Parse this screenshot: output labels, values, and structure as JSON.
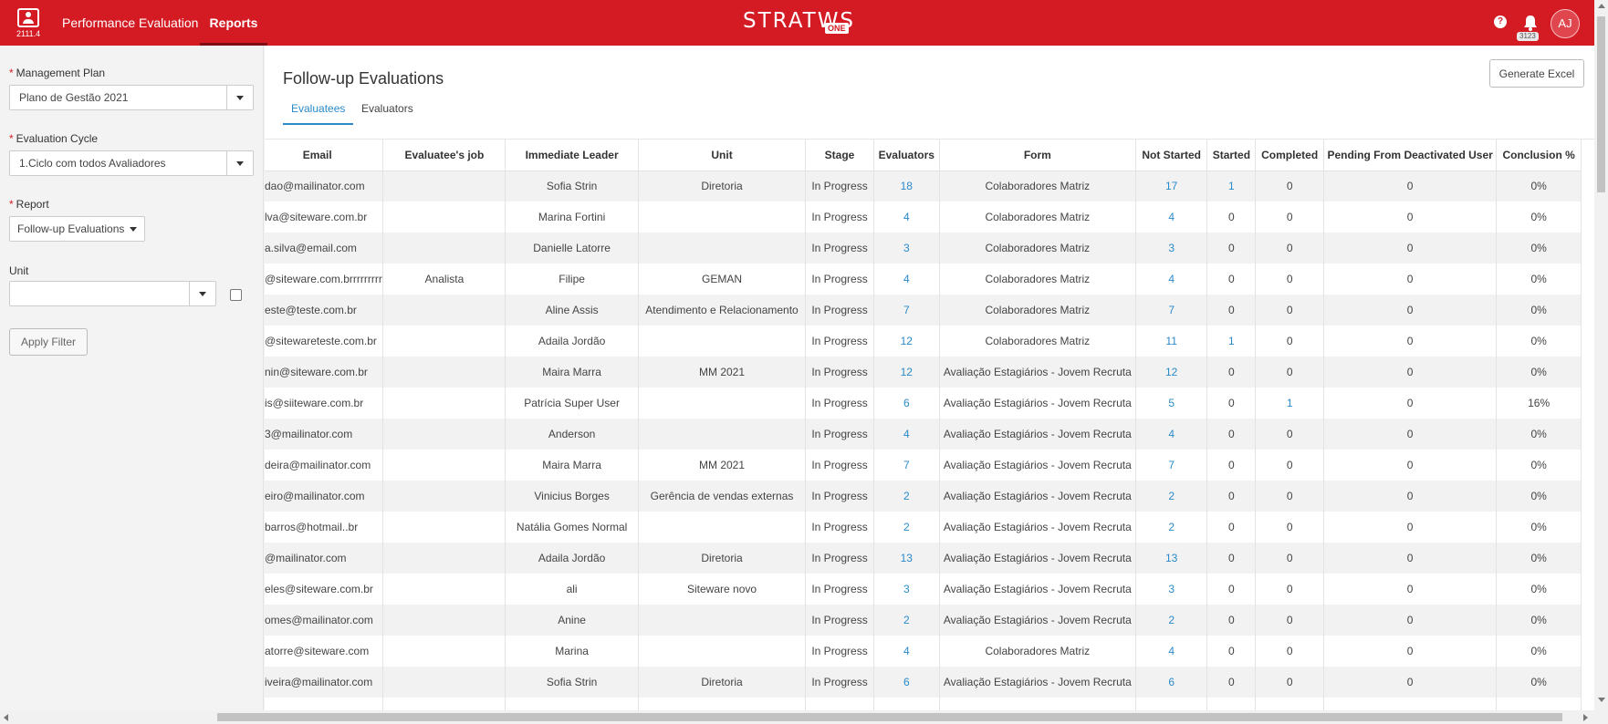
{
  "topbar": {
    "version": "2111.4",
    "nav": [
      {
        "label": "Performance Evaluation",
        "active": false
      },
      {
        "label": "Reports",
        "active": true
      }
    ],
    "logo_text": "STRATWS",
    "logo_badge": "ONE",
    "help_label": "?",
    "notification_count": "3123",
    "user_initials": "AJ",
    "brand_color": "#d41b24"
  },
  "sidebar": {
    "management_plan": {
      "label": "Management Plan",
      "value": "Plano de Gestão 2021"
    },
    "evaluation_cycle": {
      "label": "Evaluation Cycle",
      "value": "1.Ciclo com todos Avaliadores"
    },
    "report": {
      "label": "Report",
      "value": "Follow-up Evaluations"
    },
    "unit": {
      "label": "Unit",
      "value": ""
    },
    "apply_label": "Apply Filter"
  },
  "main": {
    "title": "Follow-up Evaluations",
    "generate_label": "Generate Excel",
    "tabs": [
      {
        "label": "Evaluatees",
        "active": true
      },
      {
        "label": "Evaluators",
        "active": false
      }
    ]
  },
  "table": {
    "columns": [
      "Email",
      "Evaluatee's job",
      "Immediate Leader",
      "Unit",
      "Stage",
      "Evaluators",
      "Form",
      "Not Started",
      "Started",
      "Completed",
      "Pending From Deactivated User",
      "Conclusion %"
    ],
    "rows": [
      [
        "dao@mailinator.com",
        "",
        "Sofia Strin",
        "Diretoria",
        "In Progress",
        "18",
        "Colaboradores Matriz",
        "17",
        "1",
        "0",
        "0",
        "0%"
      ],
      [
        "lva@siteware.com.br",
        "",
        "Marina Fortini",
        "",
        "In Progress",
        "4",
        "Colaboradores Matriz",
        "4",
        "0",
        "0",
        "0",
        "0%"
      ],
      [
        "a.silva@email.com",
        "",
        "Danielle Latorre",
        "",
        "In Progress",
        "3",
        "Colaboradores Matriz",
        "3",
        "0",
        "0",
        "0",
        "0%"
      ],
      [
        "@siteware.com.brrrrrrrrr",
        "Analista",
        "Filipe",
        "GEMAN",
        "In Progress",
        "4",
        "Colaboradores Matriz",
        "4",
        "0",
        "0",
        "0",
        "0%"
      ],
      [
        "este@teste.com.br",
        "",
        "Aline Assis",
        "Atendimento e Relacionamento",
        "In Progress",
        "7",
        "Colaboradores Matriz",
        "7",
        "0",
        "0",
        "0",
        "0%"
      ],
      [
        "@sitewareteste.com.br",
        "",
        "Adaila Jordão",
        "",
        "In Progress",
        "12",
        "Colaboradores Matriz",
        "11",
        "1",
        "0",
        "0",
        "0%"
      ],
      [
        "nin@siteware.com.br",
        "",
        "Maira Marra",
        "MM 2021",
        "In Progress",
        "12",
        "Avaliação Estagiários - Jovem Recruta",
        "12",
        "0",
        "0",
        "0",
        "0%"
      ],
      [
        "is@siiteware.com.br",
        "",
        "Patrícia Super User",
        "",
        "In Progress",
        "6",
        "Avaliação Estagiários - Jovem Recruta",
        "5",
        "0",
        "1",
        "0",
        "16%"
      ],
      [
        "3@mailinator.com",
        "",
        "Anderson",
        "",
        "In Progress",
        "4",
        "Avaliação Estagiários - Jovem Recruta",
        "4",
        "0",
        "0",
        "0",
        "0%"
      ],
      [
        "deira@mailinator.com",
        "",
        "Maira Marra",
        "MM 2021",
        "In Progress",
        "7",
        "Avaliação Estagiários - Jovem Recruta",
        "7",
        "0",
        "0",
        "0",
        "0%"
      ],
      [
        "eiro@mailinator.com",
        "",
        "Vinicius Borges",
        "Gerência de vendas externas",
        "In Progress",
        "2",
        "Avaliação Estagiários - Jovem Recruta",
        "2",
        "0",
        "0",
        "0",
        "0%"
      ],
      [
        "barros@hotmail..br",
        "",
        "Natália Gomes Normal",
        "",
        "In Progress",
        "2",
        "Avaliação Estagiários - Jovem Recruta",
        "2",
        "0",
        "0",
        "0",
        "0%"
      ],
      [
        "@mailinator.com",
        "",
        "Adaila Jordão",
        "Diretoria",
        "In Progress",
        "13",
        "Avaliação Estagiários - Jovem Recruta",
        "13",
        "0",
        "0",
        "0",
        "0%"
      ],
      [
        "eles@siteware.com.br",
        "",
        "ali",
        "Siteware novo",
        "In Progress",
        "3",
        "Avaliação Estagiários - Jovem Recruta",
        "3",
        "0",
        "0",
        "0",
        "0%"
      ],
      [
        "omes@mailinator.com",
        "",
        "Anine",
        "",
        "In Progress",
        "2",
        "Avaliação Estagiários - Jovem Recruta",
        "2",
        "0",
        "0",
        "0",
        "0%"
      ],
      [
        "atorre@siteware.com",
        "",
        "Marina",
        "",
        "In Progress",
        "4",
        "Colaboradores Matriz",
        "4",
        "0",
        "0",
        "0",
        "0%"
      ],
      [
        "iveira@mailinator.com",
        "",
        "Sofia Strin",
        "Diretoria",
        "In Progress",
        "6",
        "Avaliação Estagiários - Jovem Recruta",
        "6",
        "0",
        "0",
        "0",
        "0%"
      ],
      [
        "",
        "",
        "",
        "",
        "",
        "",
        "",
        "",
        "",
        "",
        "",
        ""
      ]
    ]
  }
}
